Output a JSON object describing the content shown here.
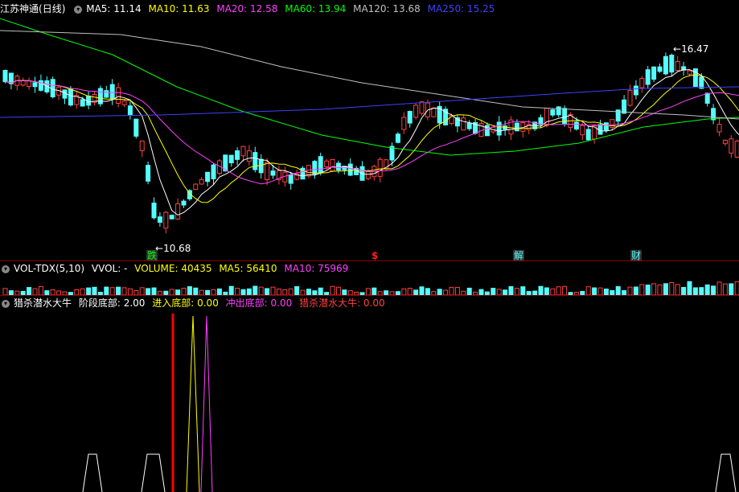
{
  "main_header": {
    "stock_name": "江苏神通",
    "period": "(日线)",
    "ma5": "MA5: 11.14",
    "ma10": "MA10: 11.63",
    "ma20": "MA20: 12.58",
    "ma60": "MA60: 13.94",
    "ma120": "MA120: 13.68",
    "ma250": "MA250: 15.25"
  },
  "price_labels": {
    "high": "16.47",
    "low": "10.68"
  },
  "event_tags": {
    "fall": "跌",
    "s": "$",
    "unlock": "解",
    "finance": "财"
  },
  "vol_header": {
    "name": "VOL-TDX(5,10)",
    "vvol": "VVOL: -",
    "volume": "VOLUME: 40435",
    "ma5": "MA5: 56410",
    "ma10": "MA10: 75969"
  },
  "ind_header": {
    "name": "猎杀潜水大牛",
    "stage": "阶段底部: 2.00",
    "enter": "进入底部: 0.00",
    "exit": "冲出底部: 0.00",
    "bull": "猎杀潜水大牛: 0.00"
  },
  "colors": {
    "up": "#ff4040",
    "down": "#54ffff",
    "ma5": "#ffffff",
    "ma10": "#ffff00",
    "ma20": "#ff40ff",
    "ma60": "#00ff00",
    "ma120": "#c0c0c0",
    "ma250": "#4040ff"
  }
}
